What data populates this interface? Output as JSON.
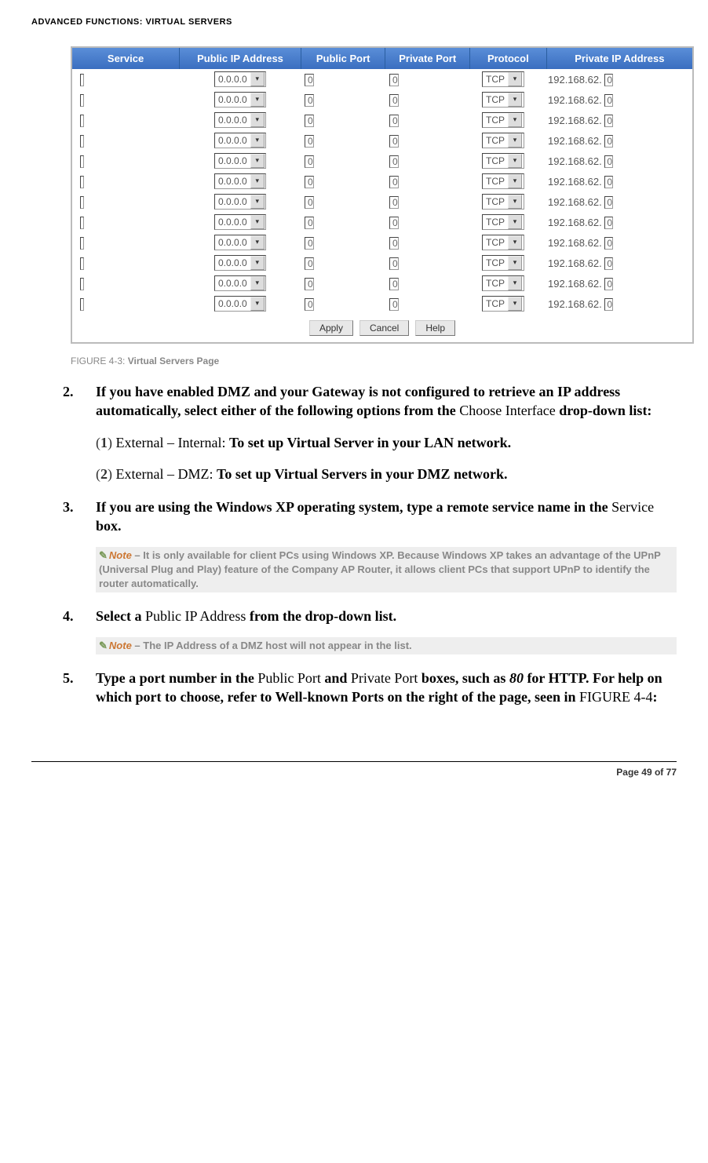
{
  "header": "ADVANCED FUNCTIONS: VIRTUAL SERVERS",
  "screenshot": {
    "headers": {
      "service": "Service",
      "public_ip": "Public IP Address",
      "public_port": "Public Port",
      "private_port": "Private Port",
      "protocol": "Protocol",
      "private_ip": "Private IP Address"
    },
    "row_defaults": {
      "ip_select": "0.0.0.0",
      "port_value": "0",
      "protocol": "TCP",
      "private_ip_prefix": "192.168.62.",
      "private_ip_suffix": "0"
    },
    "row_count": 12,
    "buttons": {
      "apply": "Apply",
      "cancel": "Cancel",
      "help": "Help"
    }
  },
  "figure": {
    "label": "FIGURE 4-3:",
    "title": "Virtual Servers Page"
  },
  "steps": {
    "s2": {
      "num": "2.",
      "text_a": "If you have enabled DMZ and your Gateway is not configured to retrieve an IP address automatically, select either of the following options from the ",
      "text_b": "Choose Interface",
      "text_c": " drop-down list:",
      "sub1_num": "(1)",
      "sub1_label": " External – Internal: ",
      "sub1_bold": "To set up Virtual Server in your LAN network.",
      "sub2_num": "(2)",
      "sub2_label": " External – DMZ: ",
      "sub2_bold": "To set up Virtual Servers in your DMZ network."
    },
    "s3": {
      "num": "3.",
      "text_a": "If you are using the Windows XP operating system, type a remote service name in the ",
      "text_b": "Service",
      "text_c": " box.",
      "note_word": "Note",
      "note_dash": " – ",
      "note_text": "It is only available for client PCs using Windows XP. Because Windows XP takes an advantage of the UPnP (Universal Plug and Play) feature of the Company AP Router, it allows client PCs that support UPnP to identify the router automatically."
    },
    "s4": {
      "num": "4.",
      "text_a": "Select a ",
      "text_b": "Public IP Address",
      "text_c": " from the drop-down list.",
      "note_word": "Note",
      "note_dash": " – ",
      "note_text": "The IP Address of a DMZ host will not appear in the list."
    },
    "s5": {
      "num": "5.",
      "text_a": "Type a port number in the ",
      "text_b": "Public Port",
      "text_c": " and ",
      "text_d": "Private Port",
      "text_e": " boxes, such as ",
      "text_f": "80",
      "text_g": " for HTTP. For help on which port to choose, refer to Well-known Ports on the right of the page, seen in ",
      "text_h": "FIGURE 4-4",
      "text_i": ":"
    }
  },
  "footer": "Page 49 of 77"
}
